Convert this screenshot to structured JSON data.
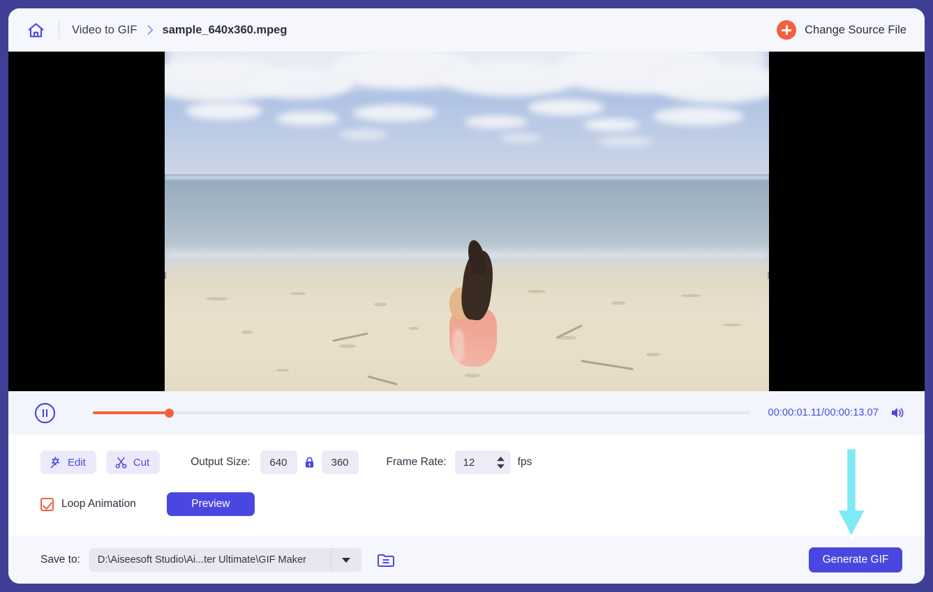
{
  "window": {
    "page_background": "#3f3f96",
    "card_background": "#ffffff"
  },
  "header": {
    "home_icon": "home-icon",
    "breadcrumb_root": "Video to GIF",
    "breadcrumb_separator": "chevron-right-icon",
    "breadcrumb_file": "sample_640x360.mpeg",
    "change_source_label": "Change Source File",
    "change_source_icon": "plus-circle-icon",
    "accent_orange": "#f4603f",
    "accent_indigo": "#4a47e0"
  },
  "video": {
    "description": "Girl in pink dress sitting on sandy beach facing the ocean under a blue cloudy sky",
    "letterbox_color": "#000000"
  },
  "player": {
    "pause_icon": "pause-icon",
    "current_time": "00:00:01.11",
    "separator": "/",
    "total_time": "00:00:13.07",
    "time_display": "00:00:01.11/00:00:13.07",
    "progress_percent": 11.6,
    "volume_icon": "volume-icon",
    "track_color": "#e3e7f1",
    "fill_color": "#f4603f"
  },
  "settings": {
    "edit_label": "Edit",
    "edit_icon": "magic-wand-icon",
    "cut_label": "Cut",
    "cut_icon": "scissors-icon",
    "output_size_label": "Output Size:",
    "output_width": "640",
    "output_height": "360",
    "lock_icon": "lock-icon",
    "frame_rate_label": "Frame Rate:",
    "frame_rate_value": "12",
    "frame_rate_unit": "fps",
    "spinner_icon": "spinner-arrows-icon",
    "loop_label": "Loop Animation",
    "loop_checked": true,
    "preview_label": "Preview"
  },
  "footer": {
    "save_to_label": "Save to:",
    "save_path": "D:\\Aiseesoft Studio\\Ai...ter Ultimate\\GIF Maker",
    "dropdown_icon": "chevron-down-icon",
    "folder_icon": "folder-icon",
    "generate_label": "Generate GIF"
  },
  "annotation": {
    "arrow_icon": "down-arrow-annotation",
    "arrow_color": "#7fe9f5",
    "arrow_outline": "#ffffff",
    "points_to": "Generate GIF"
  }
}
